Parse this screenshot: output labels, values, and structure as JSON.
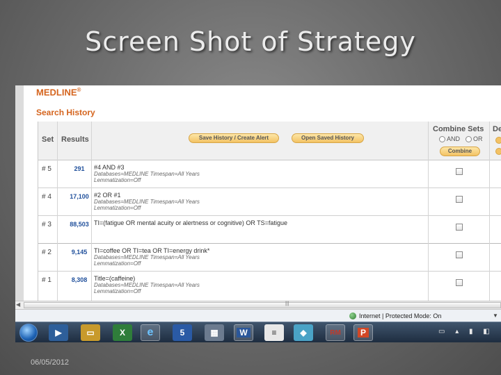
{
  "slide": {
    "title": "Screen Shot of Strategy",
    "date": "06/05/2012"
  },
  "app": {
    "brand": "MEDLINE",
    "brand_mark": "®",
    "section_title": "Search History"
  },
  "table": {
    "col_set": "Set",
    "col_results": "Results",
    "save_button": "Save History / Create Alert",
    "open_button": "Open Saved History",
    "combine_header": "Combine Sets",
    "and_label": "AND",
    "or_label": "OR",
    "combine_button": "Combine",
    "delete_header": "De",
    "rows": [
      {
        "set": "# 5",
        "results": "291",
        "query": "#4 AND #3",
        "meta1": "Databases=MEDLINE Timespan=All Years",
        "meta2": "Lemmatization=Off"
      },
      {
        "set": "# 4",
        "results": "17,100",
        "query": "#2 OR #1",
        "meta1": "Databases=MEDLINE Timespan=All Years",
        "meta2": "Lemmatization=Off"
      },
      {
        "set": "# 3",
        "results": "88,503",
        "query": "TI=(fatigue OR mental acuity or alertness or cognitive) OR TS=fatigue",
        "meta1": "",
        "meta2": ""
      },
      {
        "set": "# 2",
        "results": "9,145",
        "query": "TI=coffee OR TI=tea OR TI=energy drink*",
        "meta1": "Databases=MEDLINE Timespan=All Years",
        "meta2": "Lemmatization=Off"
      },
      {
        "set": "# 1",
        "results": "8,308",
        "query": "Title=(caffeine)",
        "meta1": "Databases=MEDLINE Timespan=All Years",
        "meta2": "Lemmatization=Off"
      }
    ]
  },
  "statusbar": {
    "text": "Internet | Protected Mode: On"
  },
  "taskbar": {
    "icons": [
      "windows-start",
      "media-player",
      "folder",
      "excel",
      "internet-explorer",
      "app-5",
      "calculator",
      "word",
      "notepad",
      "notes",
      "reference-manager",
      "powerpoint"
    ]
  },
  "colors": {
    "brand_orange": "#d5651f",
    "result_blue": "#1f4f9b",
    "button_gold": "#f3c264"
  }
}
